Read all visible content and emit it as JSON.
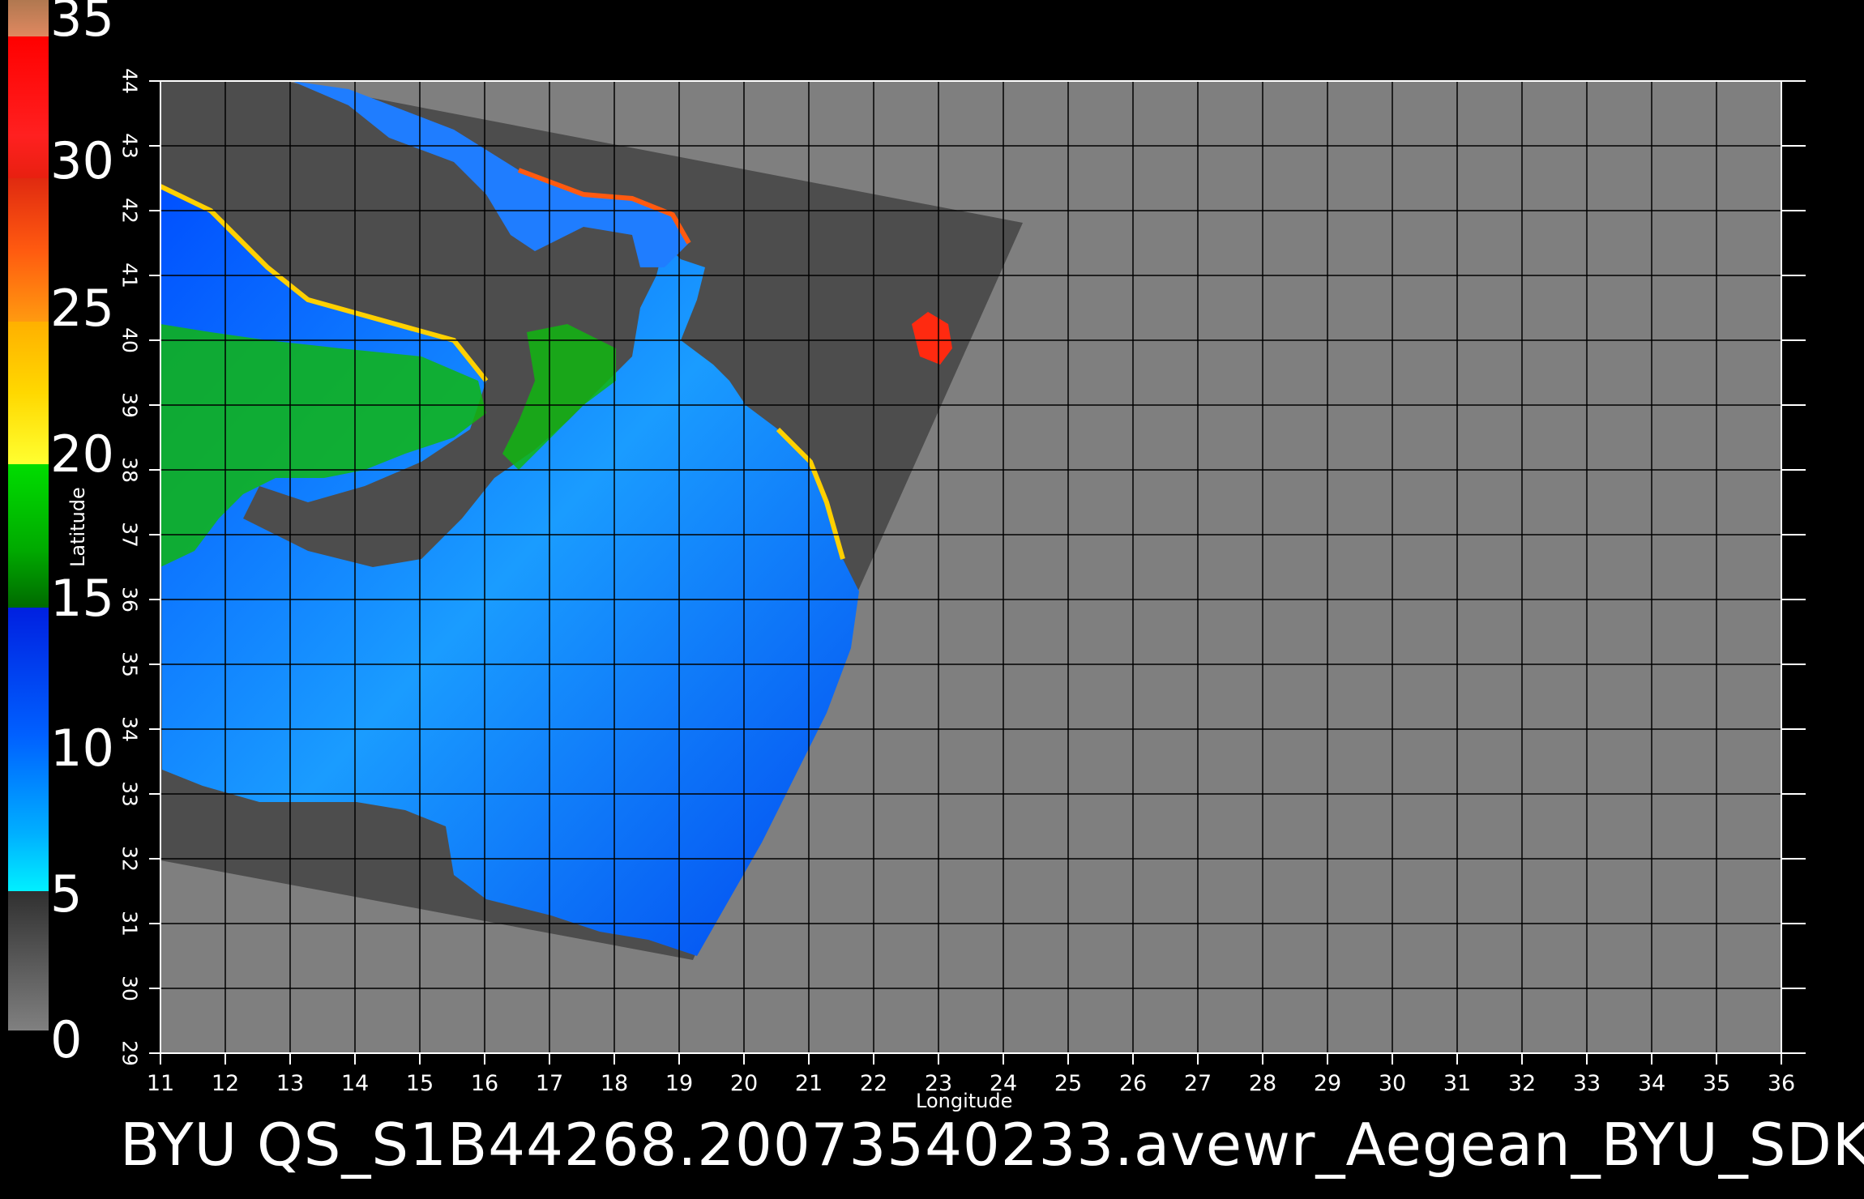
{
  "colorbar": {
    "labels": [
      "35",
      "30",
      "25",
      "20",
      "15",
      "10",
      "5",
      "0"
    ],
    "colors": {
      "top": "#c87840",
      "red": "#ff1a1a",
      "orange": "#ff7a10",
      "yellow": "#ffd700",
      "green": "#00aa00",
      "blue": "#0040ff",
      "cyan": "#00f0ff",
      "gray": "#606060"
    }
  },
  "axes": {
    "x_label": "Longitude",
    "y_label": "Latitude",
    "x_ticks": [
      "11",
      "12",
      "13",
      "14",
      "15",
      "16",
      "17",
      "18",
      "19",
      "20",
      "21",
      "22",
      "23",
      "24",
      "25",
      "26",
      "27",
      "28",
      "29",
      "30",
      "31",
      "32",
      "33",
      "34",
      "35",
      "36"
    ],
    "y_ticks": [
      "44",
      "43",
      "42",
      "41",
      "40",
      "39",
      "38",
      "37",
      "36",
      "35",
      "34",
      "33",
      "32",
      "31",
      "30",
      "29"
    ],
    "grid": true,
    "plot_background": "#7f7f7f",
    "swath_background": "#4d4d4d",
    "grid_color": "#000000"
  },
  "footer": {
    "text": "BYU  QS_S1B44268.20073540233.avewr_Aegean_BYU_SDK"
  }
}
